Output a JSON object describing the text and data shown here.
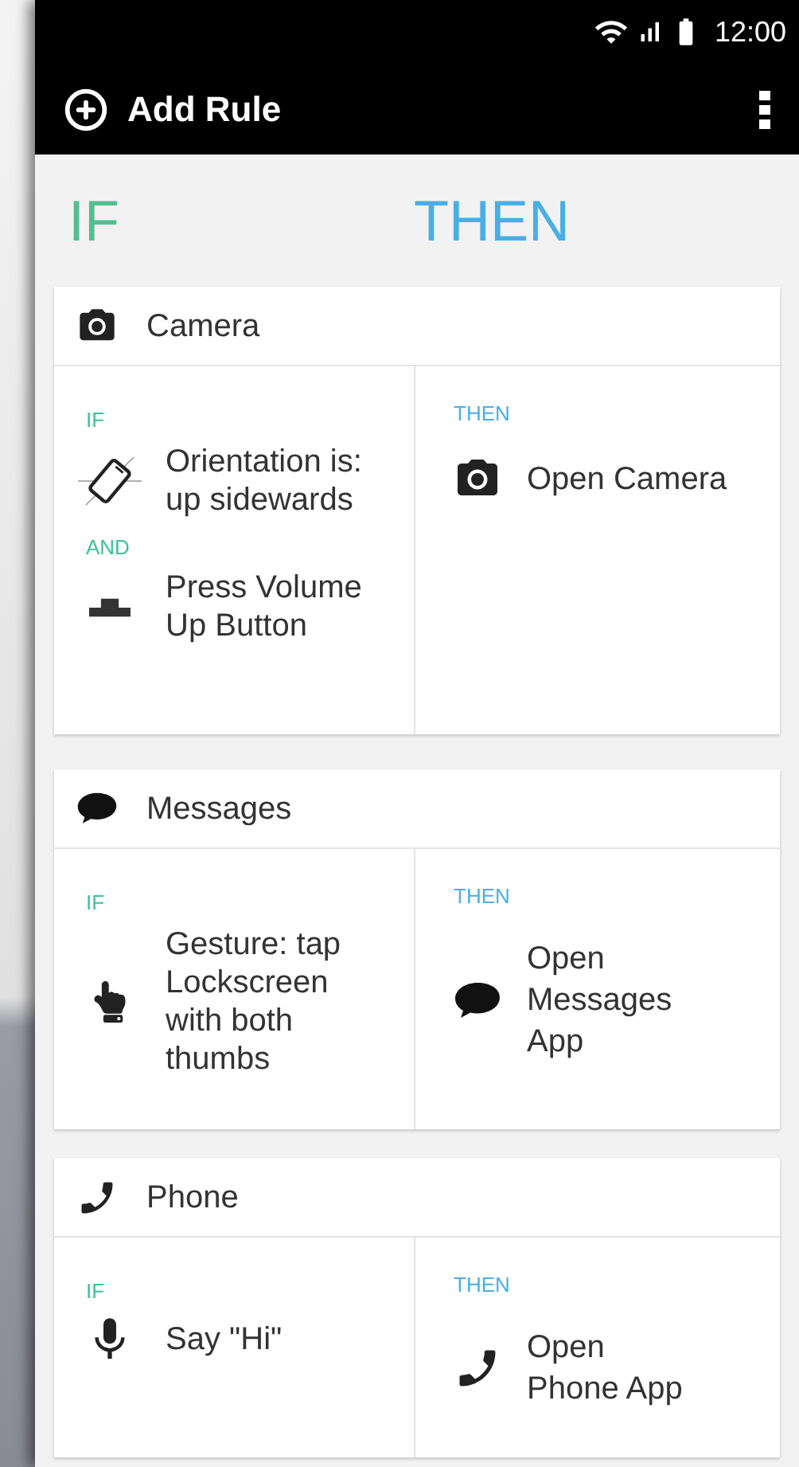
{
  "status_bar": {
    "time": "12:00"
  },
  "toolbar": {
    "title": "Add Rule"
  },
  "columns": {
    "if": "IF",
    "then": "THEN"
  },
  "rules": [
    {
      "title": "Camera",
      "kind": "camera",
      "conditions": [
        {
          "connector": "IF",
          "kind": "tilt",
          "text": "Orientation is:\nup sidewards"
        },
        {
          "connector": "AND",
          "kind": "volume",
          "text": "Press Volume\nUp Button"
        }
      ],
      "then_label": "THEN",
      "actions": [
        {
          "kind": "camera",
          "text": "Open Camera"
        }
      ]
    },
    {
      "title": "Messages",
      "kind": "chat",
      "conditions": [
        {
          "connector": "IF",
          "kind": "hand",
          "text": "Gesture: tap\nLockscreen\nwith both\nthumbs"
        }
      ],
      "then_label": "THEN",
      "actions": [
        {
          "kind": "chat",
          "text": "Open\nMessages\nApp"
        }
      ]
    },
    {
      "title": "Phone",
      "kind": "phone",
      "conditions": [
        {
          "connector": "IF",
          "kind": "mic",
          "text": "Say \"Hi\""
        }
      ],
      "then_label": "THEN",
      "actions": [
        {
          "kind": "phone",
          "text": "Open\nPhone App"
        }
      ]
    }
  ]
}
